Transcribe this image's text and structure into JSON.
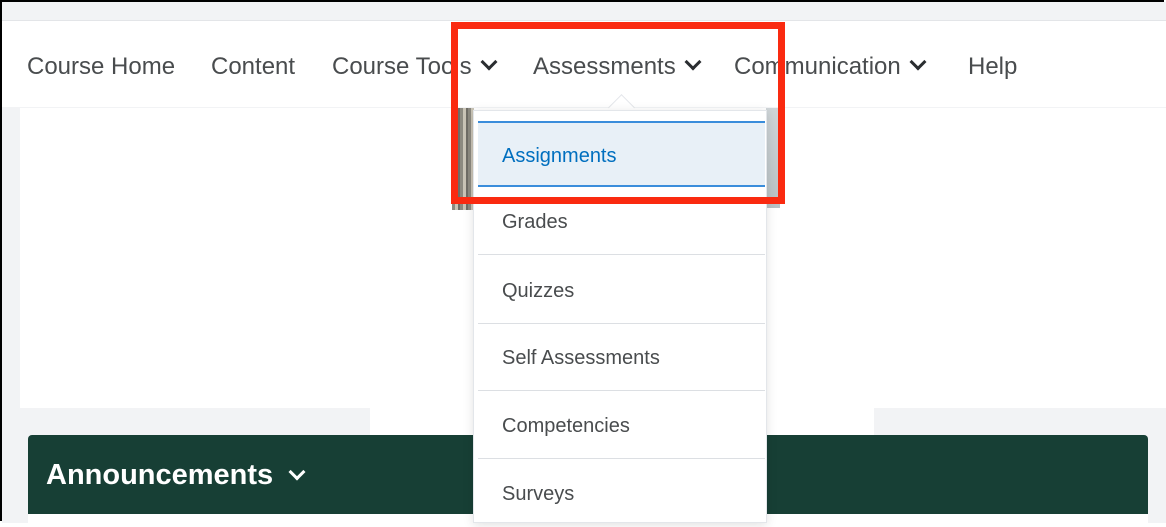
{
  "nav": {
    "items": [
      {
        "label": "Course Home",
        "has_menu": false
      },
      {
        "label": "Content",
        "has_menu": false
      },
      {
        "label": "Course Tools",
        "has_menu": true
      },
      {
        "label": "Assessments",
        "has_menu": true
      },
      {
        "label": "Communication",
        "has_menu": true
      },
      {
        "label": "Help",
        "has_menu": false
      }
    ]
  },
  "assessments_menu": {
    "items": [
      {
        "label": "Assignments",
        "state": "selected"
      },
      {
        "label": "Grades",
        "state": "normal"
      },
      {
        "label": "Quizzes",
        "state": "normal"
      },
      {
        "label": "Self Assessments",
        "state": "normal"
      },
      {
        "label": "Competencies",
        "state": "normal"
      },
      {
        "label": "Surveys",
        "state": "normal"
      }
    ]
  },
  "announcements": {
    "title": "Announcements"
  },
  "colors": {
    "highlight_box": "#fa2a10",
    "announcement_bar": "#173f35",
    "selected_item_text": "#006fbf",
    "selected_item_bg": "#e8f0f7"
  },
  "icons": {
    "nav_menu": "chevron-down-icon",
    "announcements_menu": "chevron-down-icon"
  }
}
